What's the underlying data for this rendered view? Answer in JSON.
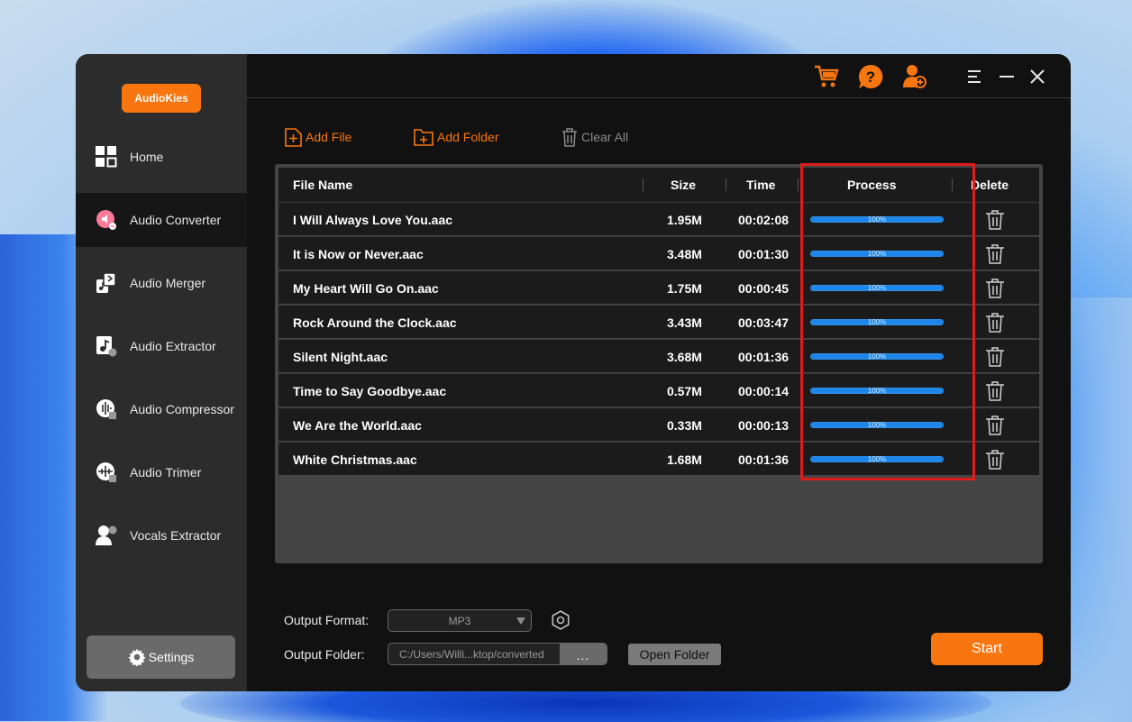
{
  "app": {
    "brand": "AudioKies"
  },
  "sidebar": {
    "items": [
      {
        "label": "Home",
        "icon": "grid-icon",
        "active": false
      },
      {
        "label": "Audio Converter",
        "icon": "audio-converter-icon",
        "active": true
      },
      {
        "label": "Audio Merger",
        "icon": "audio-merger-icon",
        "active": false
      },
      {
        "label": "Audio Extractor",
        "icon": "audio-extractor-icon",
        "active": false
      },
      {
        "label": "Audio Compressor",
        "icon": "audio-compressor-icon",
        "active": false
      },
      {
        "label": "Audio Trimer",
        "icon": "audio-trimmer-icon",
        "active": false
      },
      {
        "label": "Vocals Extractor",
        "icon": "vocals-extractor-icon",
        "active": false
      }
    ],
    "settings_label": "Settings"
  },
  "toolbar": {
    "add_file": "Add File",
    "add_folder": "Add Folder",
    "clear_all": "Clear All"
  },
  "table": {
    "columns": {
      "name": "File Name",
      "size": "Size",
      "time": "Time",
      "process": "Process",
      "delete": "Delete"
    },
    "rows": [
      {
        "name": "I Will Always Love You.aac",
        "size": "1.95M",
        "time": "00:02:08",
        "progress": "100%"
      },
      {
        "name": "It is Now or Never.aac",
        "size": "3.48M",
        "time": "00:01:30",
        "progress": "100%"
      },
      {
        "name": "My Heart Will Go On.aac",
        "size": "1.75M",
        "time": "00:00:45",
        "progress": "100%"
      },
      {
        "name": "Rock Around the Clock.aac",
        "size": "3.43M",
        "time": "00:03:47",
        "progress": "100%"
      },
      {
        "name": "Silent Night.aac",
        "size": "3.68M",
        "time": "00:01:36",
        "progress": "100%"
      },
      {
        "name": "Time to Say Goodbye.aac",
        "size": "0.57M",
        "time": "00:00:14",
        "progress": "100%"
      },
      {
        "name": "We Are the World.aac",
        "size": "0.33M",
        "time": "00:00:13",
        "progress": "100%"
      },
      {
        "name": "White Christmas.aac",
        "size": "1.68M",
        "time": "00:01:36",
        "progress": "100%"
      }
    ]
  },
  "output": {
    "format_label": "Output Format:",
    "format_value": "MP3",
    "folder_label": "Output Folder:",
    "folder_value": "C:/Users/Willi...ktop/converted",
    "browse_label": "...",
    "open_folder": "Open Folder",
    "start": "Start"
  },
  "colors": {
    "accent": "#f7760f",
    "progress": "#1d86e8",
    "highlight": "#e01b1b"
  }
}
